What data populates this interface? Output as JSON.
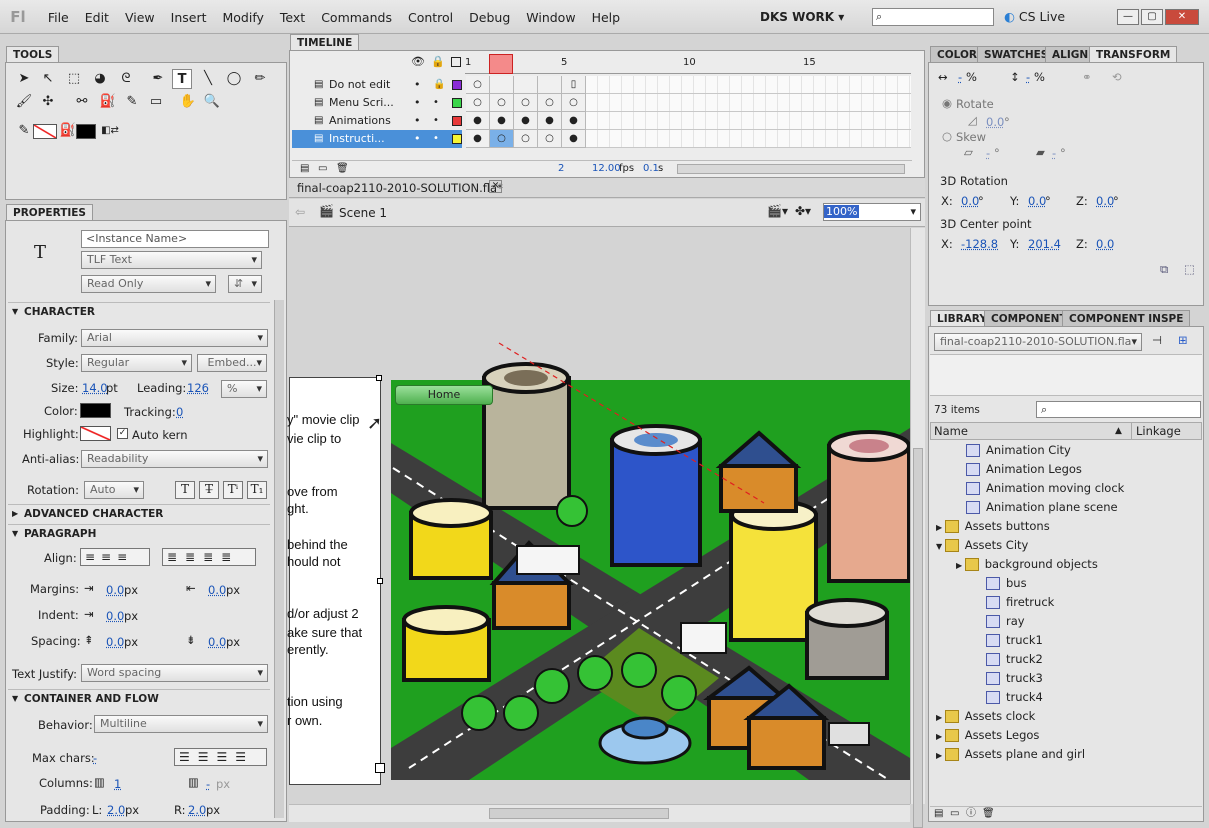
{
  "app": {
    "logo": "Fl",
    "workspace": "DKS WORK",
    "cs_live": "CS Live"
  },
  "menu": [
    "File",
    "Edit",
    "View",
    "Insert",
    "Modify",
    "Text",
    "Commands",
    "Control",
    "Debug",
    "Window",
    "Help"
  ],
  "tools_panel": {
    "title": "TOOLS"
  },
  "properties": {
    "title": "PROPERTIES",
    "instance_name_placeholder": "<Instance Name>",
    "text_engine": "TLF Text",
    "text_type": "Read Only",
    "sections": {
      "character": "CHARACTER",
      "advanced": "ADVANCED CHARACTER",
      "paragraph": "PARAGRAPH",
      "container": "CONTAINER AND FLOW"
    },
    "labels": {
      "family": "Family:",
      "style": "Style:",
      "size": "Size:",
      "leading": "Leading:",
      "color": "Color:",
      "tracking": "Tracking:",
      "highlight": "Highlight:",
      "auto_kern": "Auto kern",
      "anti_alias": "Anti-alias:",
      "rotation": "Rotation:",
      "align": "Align:",
      "margins": "Margins:",
      "indent": "Indent:",
      "spacing": "Spacing:",
      "text_justify": "Text Justify:",
      "behavior": "Behavior:",
      "max_chars": "Max chars:",
      "columns": "Columns:",
      "padding": "Padding:",
      "padding_l": "L:",
      "padding_r": "R:"
    },
    "values": {
      "family": "Arial",
      "style": "Regular",
      "embed": "Embed...",
      "size": "14.0",
      "size_unit": "pt",
      "leading": "126",
      "leading_unit": "%",
      "tracking": "0",
      "anti_alias": "Readability",
      "rotation": "Auto",
      "margin_l": "0.0",
      "margin_r": "0.0",
      "indent": "0.0",
      "spacing_b": "0.0",
      "spacing_a": "0.0",
      "px": "px",
      "text_justify": "Word spacing",
      "behavior": "Multiline",
      "max_chars": "-",
      "columns": "1",
      "column_gutter": "-",
      "padding_l": "2.0",
      "padding_r": "2.0"
    }
  },
  "timeline": {
    "title": "TIMELINE",
    "frame_numbers": [
      "1",
      "5",
      "10",
      "15"
    ],
    "layers": [
      "Do not edit",
      "Menu Scri...",
      "Animations",
      "Instructi..."
    ],
    "layer_colors": [
      "#8a2bd6",
      "#3ad64a",
      "#e8393a",
      "#f5f533"
    ],
    "status": {
      "frame": "2",
      "fps": "12.00",
      "fps_unit": "fps",
      "time": "0.1",
      "time_unit": "s"
    }
  },
  "document": {
    "tab": "final-coap2110-2010-SOLUTION.fla*",
    "scene": "Scene 1",
    "zoom": "100%"
  },
  "stage": {
    "home_button": "Home",
    "text_lines": [
      "y\" movie clip",
      "vie clip to",
      "ove from",
      "ght.",
      "behind the",
      "hould not",
      "d/or adjust 2",
      "ake sure that",
      "erently.",
      "tion using",
      "r own."
    ]
  },
  "right_top_tabs": [
    "COLOR",
    "SWATCHES",
    "ALIGN",
    "TRANSFORM"
  ],
  "transform": {
    "scale_w": "-",
    "scale_h": "-",
    "pct": "%",
    "rotate": "Rotate",
    "rotate_val": "0.0",
    "skew": "Skew",
    "skew_h": "-",
    "skew_v": "-",
    "deg": "°",
    "rot3d": "3D Rotation",
    "x_lbl": "X:",
    "y_lbl": "Y:",
    "z_lbl": "Z:",
    "rx": "0.0",
    "ry": "0.0",
    "rz": "0.0",
    "center": "3D Center point",
    "cx": "-128.8",
    "cy": "201.4",
    "cz": "0.0"
  },
  "library": {
    "tabs": [
      "LIBRARY",
      "COMPONENTS",
      "COMPONENT INSPE"
    ],
    "file": "final-coap2110-2010-SOLUTION.fla",
    "count": "73 items",
    "col_name": "Name",
    "col_linkage": "Linkage",
    "items": [
      {
        "name": "Animation City",
        "type": "sym",
        "indent": 1
      },
      {
        "name": "Animation Legos",
        "type": "sym",
        "indent": 1
      },
      {
        "name": "Animation moving clock",
        "type": "sym",
        "indent": 1
      },
      {
        "name": "Animation plane scene",
        "type": "sym",
        "indent": 1
      },
      {
        "name": "Assets buttons",
        "type": "folder",
        "indent": 0
      },
      {
        "name": "Assets City",
        "type": "folder",
        "indent": 0
      },
      {
        "name": "background objects",
        "type": "folder",
        "indent": 1
      },
      {
        "name": "bus",
        "type": "sym",
        "indent": 2
      },
      {
        "name": "firetruck",
        "type": "sym",
        "indent": 2
      },
      {
        "name": "ray",
        "type": "sym",
        "indent": 2
      },
      {
        "name": "truck1",
        "type": "sym",
        "indent": 2
      },
      {
        "name": "truck2",
        "type": "sym",
        "indent": 2
      },
      {
        "name": "truck3",
        "type": "sym",
        "indent": 2
      },
      {
        "name": "truck4",
        "type": "sym",
        "indent": 2
      },
      {
        "name": "Assets clock",
        "type": "folder",
        "indent": 0
      },
      {
        "name": "Assets Legos",
        "type": "folder",
        "indent": 0
      },
      {
        "name": "Assets plane and girl",
        "type": "folder",
        "indent": 0
      }
    ]
  }
}
